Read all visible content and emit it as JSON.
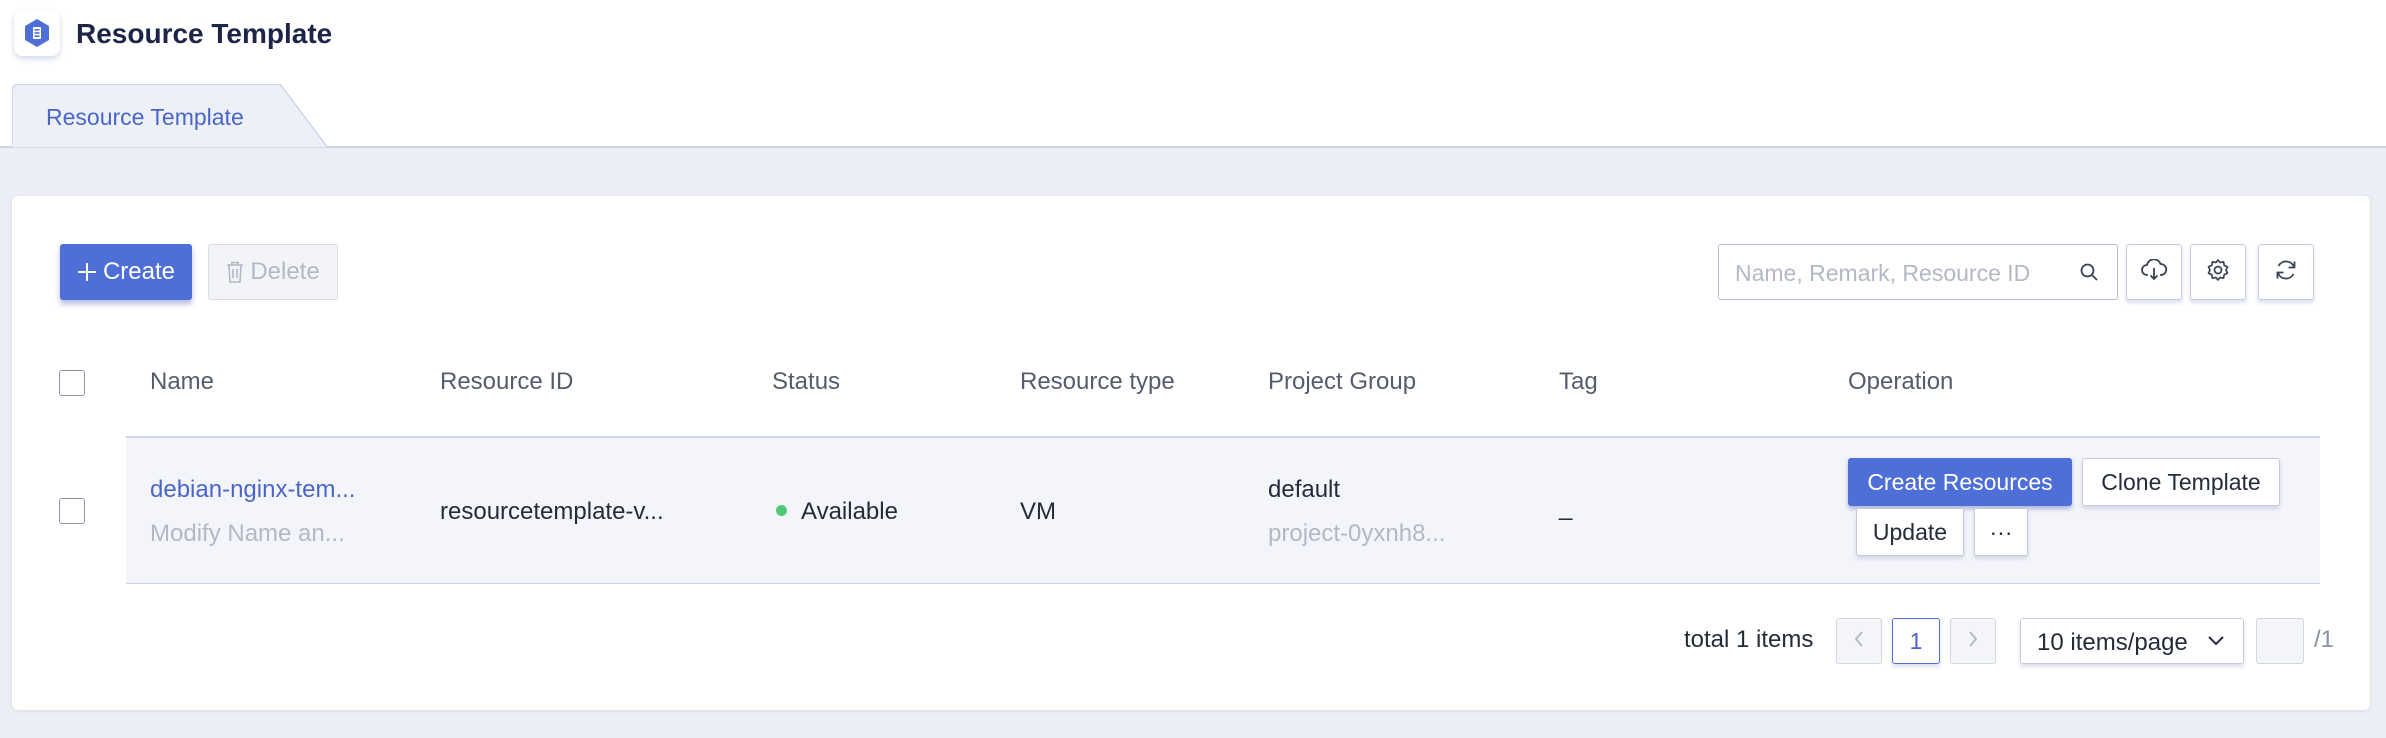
{
  "header": {
    "title": "Resource Template",
    "logo_icon": "resource-template-icon"
  },
  "tabs": [
    {
      "label": "Resource Template",
      "active": true
    }
  ],
  "toolbar": {
    "create_label": "Create",
    "delete_label": "Delete",
    "search_placeholder": "Name, Remark, Resource ID",
    "icons": [
      "cloud-download-icon",
      "gear-icon",
      "refresh-icon"
    ]
  },
  "table": {
    "columns": [
      "Name",
      "Resource ID",
      "Status",
      "Resource type",
      "Project Group",
      "Tag",
      "Operation"
    ],
    "rows": [
      {
        "name": "debian-nginx-tem...",
        "remark": "Modify Name an...",
        "resource_id": "resourcetemplate-v...",
        "status": "Available",
        "resource_type": "VM",
        "project_group": "default",
        "project_id": "project-0yxnh8...",
        "tag": "_",
        "operations": [
          "Create Resources",
          "Clone Template",
          "Update",
          "···"
        ]
      }
    ]
  },
  "pagination": {
    "total_text": "total 1 items",
    "current_page": "1",
    "page_size": "10 items/page",
    "page_count": "/1"
  },
  "colors": {
    "accent": "#4f6fd8",
    "link": "#4a66c8",
    "status_available": "#50c878"
  }
}
